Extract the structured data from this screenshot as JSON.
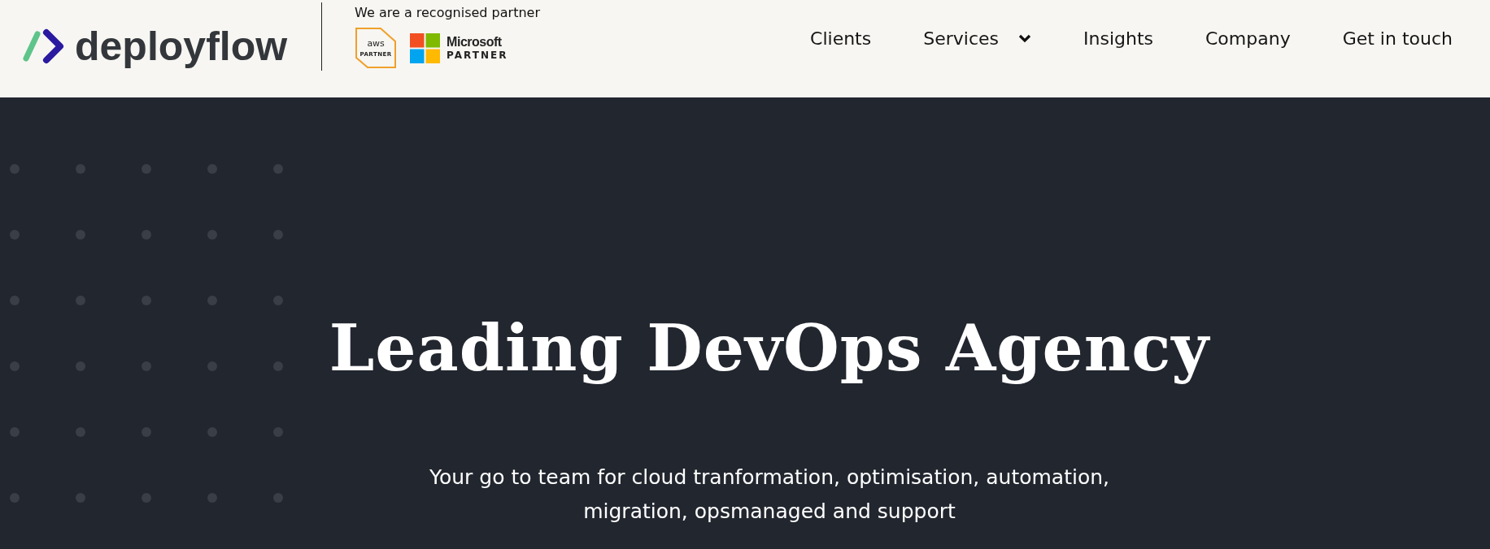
{
  "header": {
    "logo": "deployflow",
    "partner_caption": "We are a recognised partner",
    "aws_badge": {
      "brand": "aws",
      "label": "PARTNER"
    },
    "microsoft_badge": {
      "brand": "Microsoft",
      "label": "PARTNER"
    },
    "nav": [
      {
        "label": "Clients",
        "kind": "link"
      },
      {
        "label": "Services",
        "kind": "dropdown"
      },
      {
        "label": "Insights",
        "kind": "link"
      },
      {
        "label": "Company",
        "kind": "link"
      },
      {
        "label": "Get in touch",
        "kind": "link"
      }
    ]
  },
  "hero": {
    "title": "Leading DevOps Agency",
    "subtitle": "Your go to team for cloud tranformation, optimisation, automation, migration, opsmanaged and support"
  }
}
